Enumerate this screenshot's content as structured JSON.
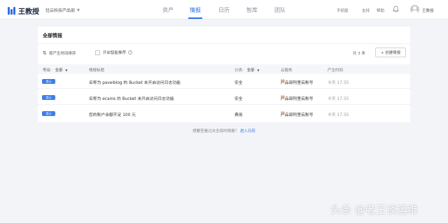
{
  "brand": {
    "name": "王教授",
    "org": "铨云科技产品部"
  },
  "nav": [
    {
      "label": "资产",
      "active": false
    },
    {
      "label": "情报",
      "active": true
    },
    {
      "label": "日历",
      "active": false
    },
    {
      "label": "智库",
      "active": false
    },
    {
      "label": "团队",
      "active": false
    }
  ],
  "header_right": {
    "mobile": "手机版",
    "support": "支持",
    "help": "帮助",
    "user": "王教授"
  },
  "card": {
    "title": "全部情报",
    "sort_label": "按产生时间排序",
    "smart_label": "开启智能推荐",
    "smart_checked": false,
    "count": "共 3 条",
    "create_label": "+ 创建情报"
  },
  "table": {
    "headers": {
      "level": "等级:",
      "level_value": "全部",
      "title": "情报标题",
      "category": "分类:",
      "category_value": "全部",
      "cloud": "云服务",
      "time": "产生时间"
    },
    "rows": [
      {
        "level": "提示",
        "title": "名称为 pavelblog 的 Bucket 未开启访问日志功能",
        "category": "安全",
        "cloud": "产品部阿里云账号",
        "time": "今天 17:35"
      },
      {
        "level": "提示",
        "title": "名称为 ecams 的 Bucket 未开启访问日志功能",
        "category": "安全",
        "cloud": "产品部阿里云账号",
        "time": "今天 17:35"
      },
      {
        "level": "提示",
        "title": "您的账户余额不足 100 元",
        "category": "费用",
        "cloud": "产品部阿里云账号",
        "time": "今天 17:35"
      }
    ]
  },
  "footer": {
    "text": "想要查看过去全部的情报？",
    "link": "进入日历"
  },
  "watermark": "头条 @老王谈运维",
  "colors": {
    "accent": "#2f6fe6",
    "tag": "#3f7ee8",
    "aliyun": "#f06a2a"
  }
}
